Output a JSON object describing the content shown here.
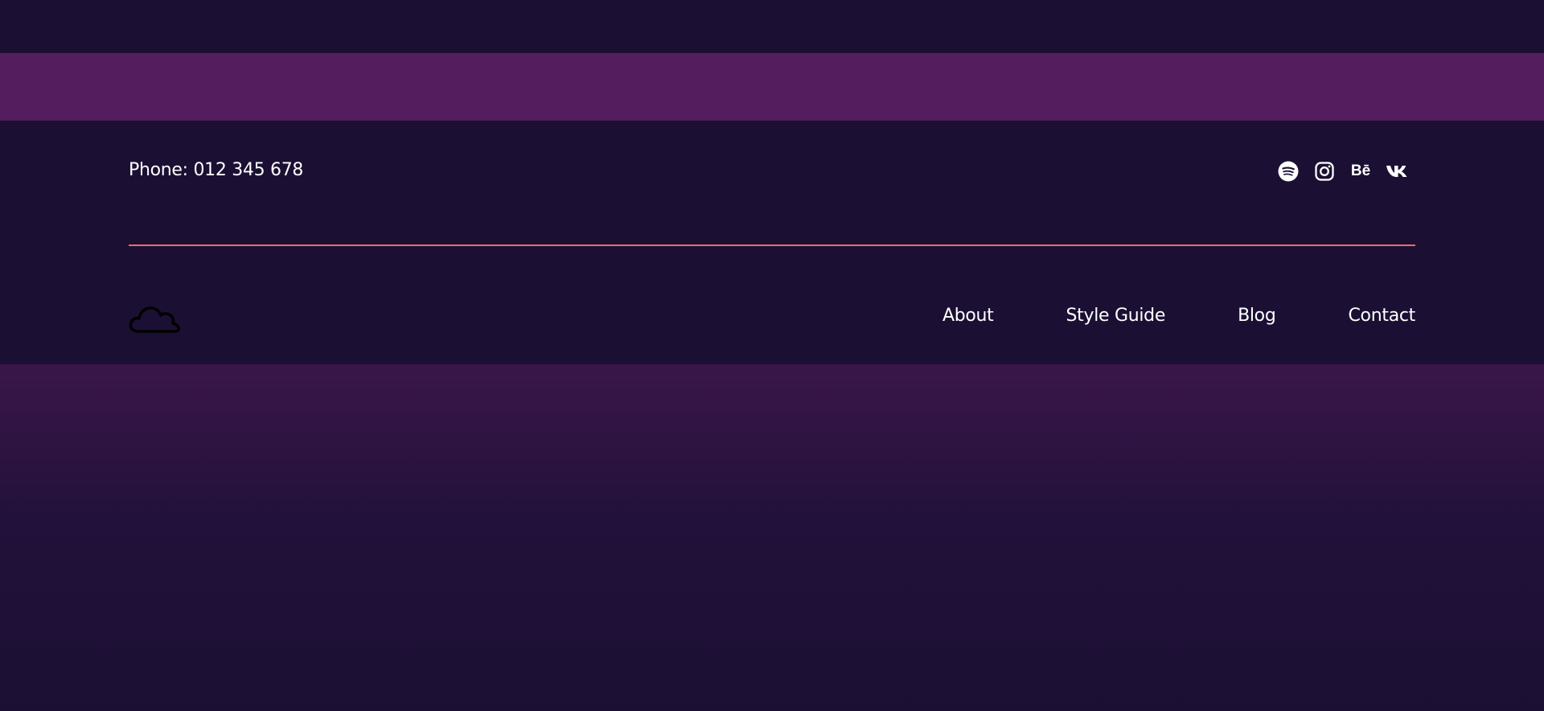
{
  "colors": {
    "background": "#1b1033",
    "band": "#541e5e",
    "divider": "#ff6b6b",
    "text": "#ffffff"
  },
  "contact": {
    "phone": "Phone: 012 345 678"
  },
  "social": [
    {
      "name": "spotify-icon"
    },
    {
      "name": "instagram-icon"
    },
    {
      "name": "behance-icon",
      "glyph": "Bē"
    },
    {
      "name": "vk-icon"
    }
  ],
  "logo": {
    "icon": "cloud-icon"
  },
  "nav": {
    "items": [
      {
        "label": "About"
      },
      {
        "label": "Style Guide"
      },
      {
        "label": "Blog"
      },
      {
        "label": "Contact"
      }
    ]
  }
}
